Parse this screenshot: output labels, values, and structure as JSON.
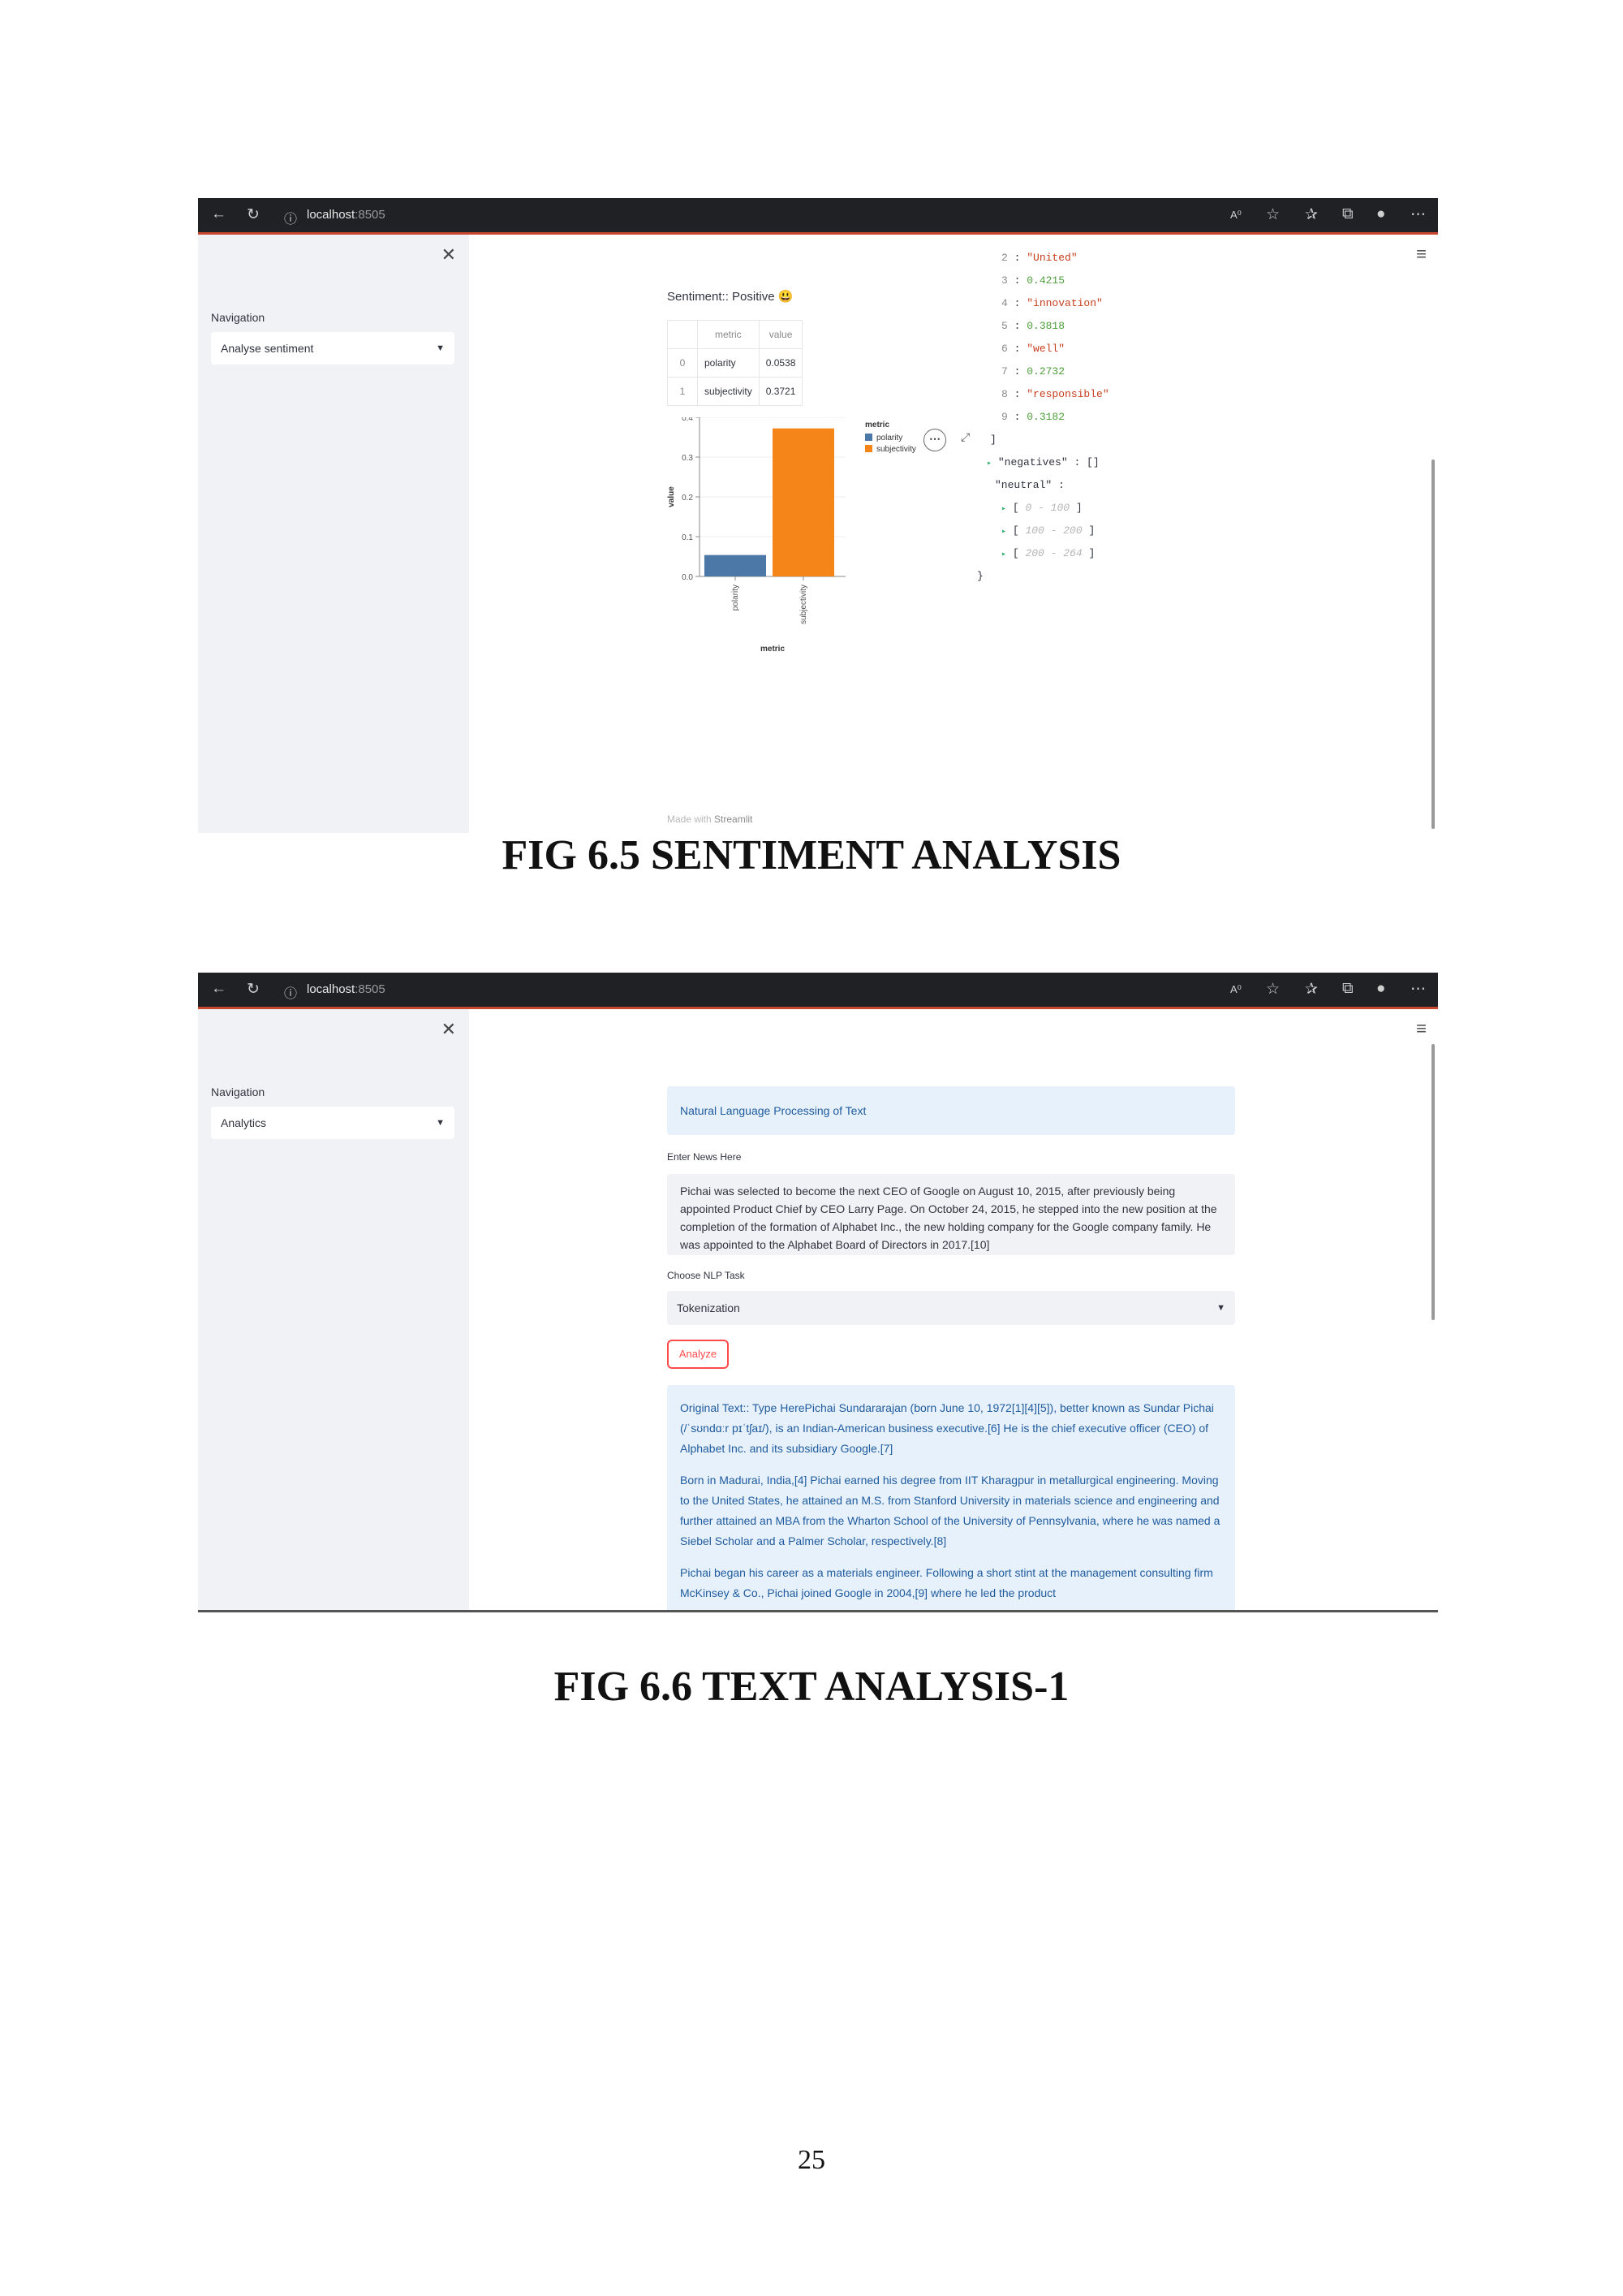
{
  "screenshot1": {
    "browser": {
      "url_host": "localhost",
      "url_port": ":8505"
    },
    "sidebar": {
      "close_glyph": "✕",
      "nav_label": "Navigation",
      "selected": "Analyse sentiment"
    },
    "sentiment_label": "Sentiment:: Positive",
    "sentiment_emoji": "😃",
    "table": {
      "headers": [
        "metric",
        "value"
      ],
      "rows": [
        {
          "index": "0",
          "metric": "polarity",
          "value": "0.0538"
        },
        {
          "index": "1",
          "metric": "subjectivity",
          "value": "0.3721"
        }
      ]
    },
    "chart_data": {
      "type": "bar",
      "categories": [
        "polarity",
        "subjectivity"
      ],
      "values": [
        0.0538,
        0.3721
      ],
      "colors": [
        "#4c78a8",
        "#f58518"
      ],
      "xlabel": "metric",
      "ylabel": "value",
      "ylim": [
        0,
        0.4
      ],
      "yticks": [
        "0.0",
        "0.1",
        "0.2",
        "0.3",
        "0.4"
      ],
      "legend_title": "metric",
      "legend_position": "right",
      "legend": [
        "polarity",
        "subjectivity"
      ]
    },
    "json": {
      "items": [
        {
          "k": "2",
          "v": "\"United\"",
          "t": "str"
        },
        {
          "k": "3",
          "v": "0.4215",
          "t": "num"
        },
        {
          "k": "4",
          "v": "\"innovation\"",
          "t": "str"
        },
        {
          "k": "5",
          "v": "0.3818",
          "t": "num"
        },
        {
          "k": "6",
          "v": "\"well\"",
          "t": "str"
        },
        {
          "k": "7",
          "v": "0.2732",
          "t": "num"
        },
        {
          "k": "8",
          "v": "\"responsible\"",
          "t": "str"
        },
        {
          "k": "9",
          "v": "0.3182",
          "t": "num"
        }
      ],
      "close_bracket": "]",
      "negatives": "\"negatives\" : []",
      "neutral": "\"neutral\" :",
      "ranges": [
        "0 - 100",
        "100 - 200",
        "200 - 264"
      ],
      "close_brace": "}"
    },
    "footer": {
      "made_with": "Made with",
      "brand": "Streamlit"
    }
  },
  "caption1": "FIG 6.5 SENTIMENT ANALYSIS",
  "screenshot2": {
    "browser": {
      "url_host": "localhost",
      "url_port": ":8505"
    },
    "sidebar": {
      "close_glyph": "✕",
      "nav_label": "Navigation",
      "selected": "Analytics"
    },
    "title": "Natural Language Processing of Text",
    "input_label": "Enter News Here",
    "input_text": "Pichai was selected to become the next CEO of Google on August 10, 2015, after previously being appointed Product Chief by CEO Larry Page. On October 24, 2015, he stepped into the new position at the completion of the formation of Alphabet Inc., the new holding company for the Google company family. He was appointed to the Alphabet Board of Directors in 2017.[10]",
    "task_label": "Choose NLP Task",
    "task_selected": "Tokenization",
    "analyze_button": "Analyze",
    "result_paragraphs": [
      "Original Text:: Type HerePichai Sundararajan (born June 10, 1972[1][4][5]), better known as Sundar Pichai (/ˈsʊndɑːr pɪˈtʃaɪ/), is an Indian-American business executive.[6] He is the chief executive officer (CEO) of Alphabet Inc. and its subsidiary Google.[7]",
      "Born in Madurai, India,[4] Pichai earned his degree from IIT Kharagpur in metallurgical engineering. Moving to the United States, he attained an M.S. from Stanford University in materials science and engineering and further attained an MBA from the Wharton School of the University of Pennsylvania, where he was named a Siebel Scholar and a Palmer Scholar, respectively.[8]",
      "Pichai began his career as a materials engineer. Following a short stint at the management consulting firm McKinsey & Co., Pichai joined Google in 2004,[9] where he led the product"
    ]
  },
  "caption2": "FIG 6.6 TEXT ANALYSIS-1",
  "page_number": "25"
}
